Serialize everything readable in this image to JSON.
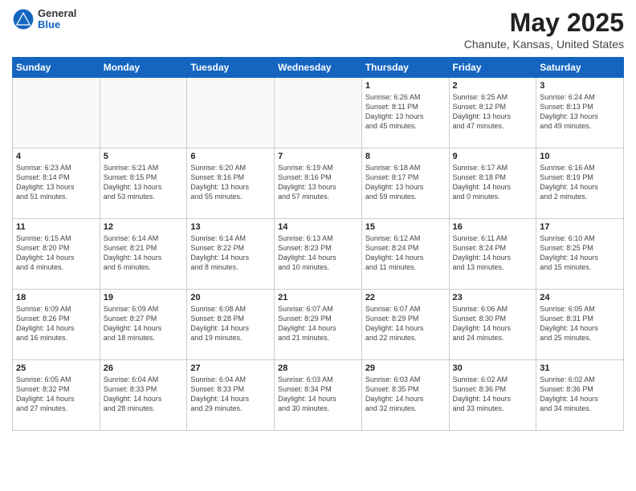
{
  "header": {
    "logo_general": "General",
    "logo_blue": "Blue",
    "month_title": "May 2025",
    "location": "Chanute, Kansas, United States"
  },
  "days_of_week": [
    "Sunday",
    "Monday",
    "Tuesday",
    "Wednesday",
    "Thursday",
    "Friday",
    "Saturday"
  ],
  "weeks": [
    [
      {
        "day": "",
        "info": ""
      },
      {
        "day": "",
        "info": ""
      },
      {
        "day": "",
        "info": ""
      },
      {
        "day": "",
        "info": ""
      },
      {
        "day": "1",
        "info": "Sunrise: 6:26 AM\nSunset: 8:11 PM\nDaylight: 13 hours\nand 45 minutes."
      },
      {
        "day": "2",
        "info": "Sunrise: 6:25 AM\nSunset: 8:12 PM\nDaylight: 13 hours\nand 47 minutes."
      },
      {
        "day": "3",
        "info": "Sunrise: 6:24 AM\nSunset: 8:13 PM\nDaylight: 13 hours\nand 49 minutes."
      }
    ],
    [
      {
        "day": "4",
        "info": "Sunrise: 6:23 AM\nSunset: 8:14 PM\nDaylight: 13 hours\nand 51 minutes."
      },
      {
        "day": "5",
        "info": "Sunrise: 6:21 AM\nSunset: 8:15 PM\nDaylight: 13 hours\nand 53 minutes."
      },
      {
        "day": "6",
        "info": "Sunrise: 6:20 AM\nSunset: 8:16 PM\nDaylight: 13 hours\nand 55 minutes."
      },
      {
        "day": "7",
        "info": "Sunrise: 6:19 AM\nSunset: 8:16 PM\nDaylight: 13 hours\nand 57 minutes."
      },
      {
        "day": "8",
        "info": "Sunrise: 6:18 AM\nSunset: 8:17 PM\nDaylight: 13 hours\nand 59 minutes."
      },
      {
        "day": "9",
        "info": "Sunrise: 6:17 AM\nSunset: 8:18 PM\nDaylight: 14 hours\nand 0 minutes."
      },
      {
        "day": "10",
        "info": "Sunrise: 6:16 AM\nSunset: 8:19 PM\nDaylight: 14 hours\nand 2 minutes."
      }
    ],
    [
      {
        "day": "11",
        "info": "Sunrise: 6:15 AM\nSunset: 8:20 PM\nDaylight: 14 hours\nand 4 minutes."
      },
      {
        "day": "12",
        "info": "Sunrise: 6:14 AM\nSunset: 8:21 PM\nDaylight: 14 hours\nand 6 minutes."
      },
      {
        "day": "13",
        "info": "Sunrise: 6:14 AM\nSunset: 8:22 PM\nDaylight: 14 hours\nand 8 minutes."
      },
      {
        "day": "14",
        "info": "Sunrise: 6:13 AM\nSunset: 8:23 PM\nDaylight: 14 hours\nand 10 minutes."
      },
      {
        "day": "15",
        "info": "Sunrise: 6:12 AM\nSunset: 8:24 PM\nDaylight: 14 hours\nand 11 minutes."
      },
      {
        "day": "16",
        "info": "Sunrise: 6:11 AM\nSunset: 8:24 PM\nDaylight: 14 hours\nand 13 minutes."
      },
      {
        "day": "17",
        "info": "Sunrise: 6:10 AM\nSunset: 8:25 PM\nDaylight: 14 hours\nand 15 minutes."
      }
    ],
    [
      {
        "day": "18",
        "info": "Sunrise: 6:09 AM\nSunset: 8:26 PM\nDaylight: 14 hours\nand 16 minutes."
      },
      {
        "day": "19",
        "info": "Sunrise: 6:09 AM\nSunset: 8:27 PM\nDaylight: 14 hours\nand 18 minutes."
      },
      {
        "day": "20",
        "info": "Sunrise: 6:08 AM\nSunset: 8:28 PM\nDaylight: 14 hours\nand 19 minutes."
      },
      {
        "day": "21",
        "info": "Sunrise: 6:07 AM\nSunset: 8:29 PM\nDaylight: 14 hours\nand 21 minutes."
      },
      {
        "day": "22",
        "info": "Sunrise: 6:07 AM\nSunset: 8:29 PM\nDaylight: 14 hours\nand 22 minutes."
      },
      {
        "day": "23",
        "info": "Sunrise: 6:06 AM\nSunset: 8:30 PM\nDaylight: 14 hours\nand 24 minutes."
      },
      {
        "day": "24",
        "info": "Sunrise: 6:05 AM\nSunset: 8:31 PM\nDaylight: 14 hours\nand 25 minutes."
      }
    ],
    [
      {
        "day": "25",
        "info": "Sunrise: 6:05 AM\nSunset: 8:32 PM\nDaylight: 14 hours\nand 27 minutes."
      },
      {
        "day": "26",
        "info": "Sunrise: 6:04 AM\nSunset: 8:33 PM\nDaylight: 14 hours\nand 28 minutes."
      },
      {
        "day": "27",
        "info": "Sunrise: 6:04 AM\nSunset: 8:33 PM\nDaylight: 14 hours\nand 29 minutes."
      },
      {
        "day": "28",
        "info": "Sunrise: 6:03 AM\nSunset: 8:34 PM\nDaylight: 14 hours\nand 30 minutes."
      },
      {
        "day": "29",
        "info": "Sunrise: 6:03 AM\nSunset: 8:35 PM\nDaylight: 14 hours\nand 32 minutes."
      },
      {
        "day": "30",
        "info": "Sunrise: 6:02 AM\nSunset: 8:36 PM\nDaylight: 14 hours\nand 33 minutes."
      },
      {
        "day": "31",
        "info": "Sunrise: 6:02 AM\nSunset: 8:36 PM\nDaylight: 14 hours\nand 34 minutes."
      }
    ]
  ]
}
